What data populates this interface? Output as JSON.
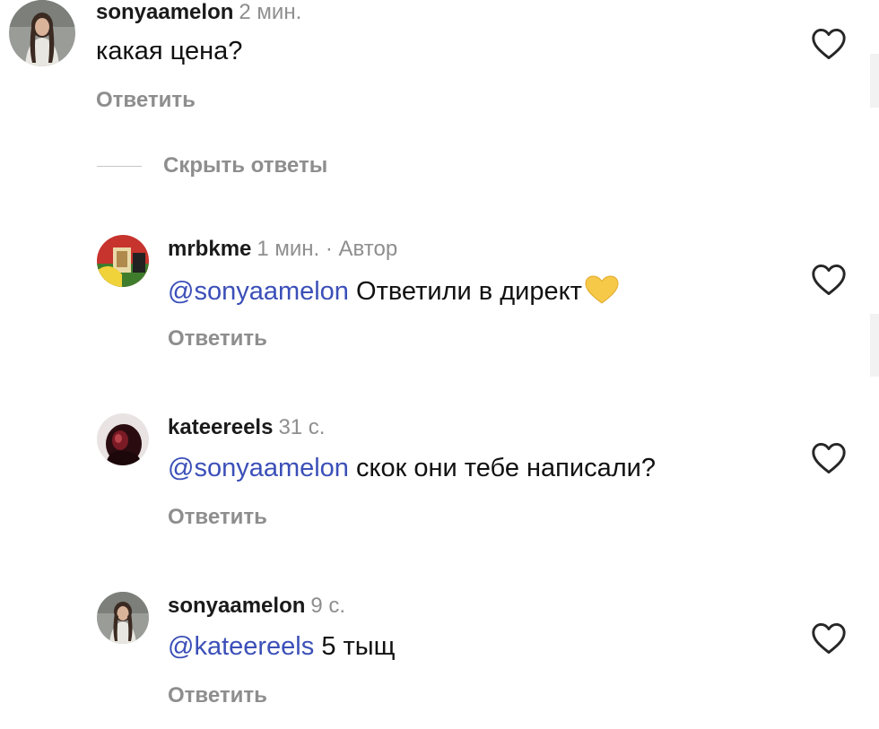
{
  "comments": [
    {
      "username": "sonyaamelon",
      "time": "2 мин.",
      "author_tag": "",
      "mention": "",
      "text": "какая цена?",
      "reply_label": "Ответить"
    },
    {
      "username": "mrbkme",
      "time": "1 мин.",
      "author_tag": "· Автор",
      "mention": "@sonyaamelon",
      "text": "Ответили в директ",
      "emoji": "yellow-heart",
      "reply_label": "Ответить"
    },
    {
      "username": "kateereels",
      "time": "31 с.",
      "author_tag": "",
      "mention": "@sonyaamelon",
      "text": "скок они тебе написали?",
      "reply_label": "Ответить"
    },
    {
      "username": "sonyaamelon",
      "time": "9 с.",
      "author_tag": "",
      "mention": "@kateereels",
      "text": "5 тыщ",
      "reply_label": "Ответить"
    }
  ],
  "hide_replies_label": "Скрыть ответы",
  "icons": {
    "like": "heart-outline-icon",
    "emoji": "yellow-heart-emoji"
  },
  "colors": {
    "mention": "#3b4fb8",
    "muted": "#8e8e8e",
    "text": "#111111",
    "yellow_heart": "#f7c948"
  }
}
